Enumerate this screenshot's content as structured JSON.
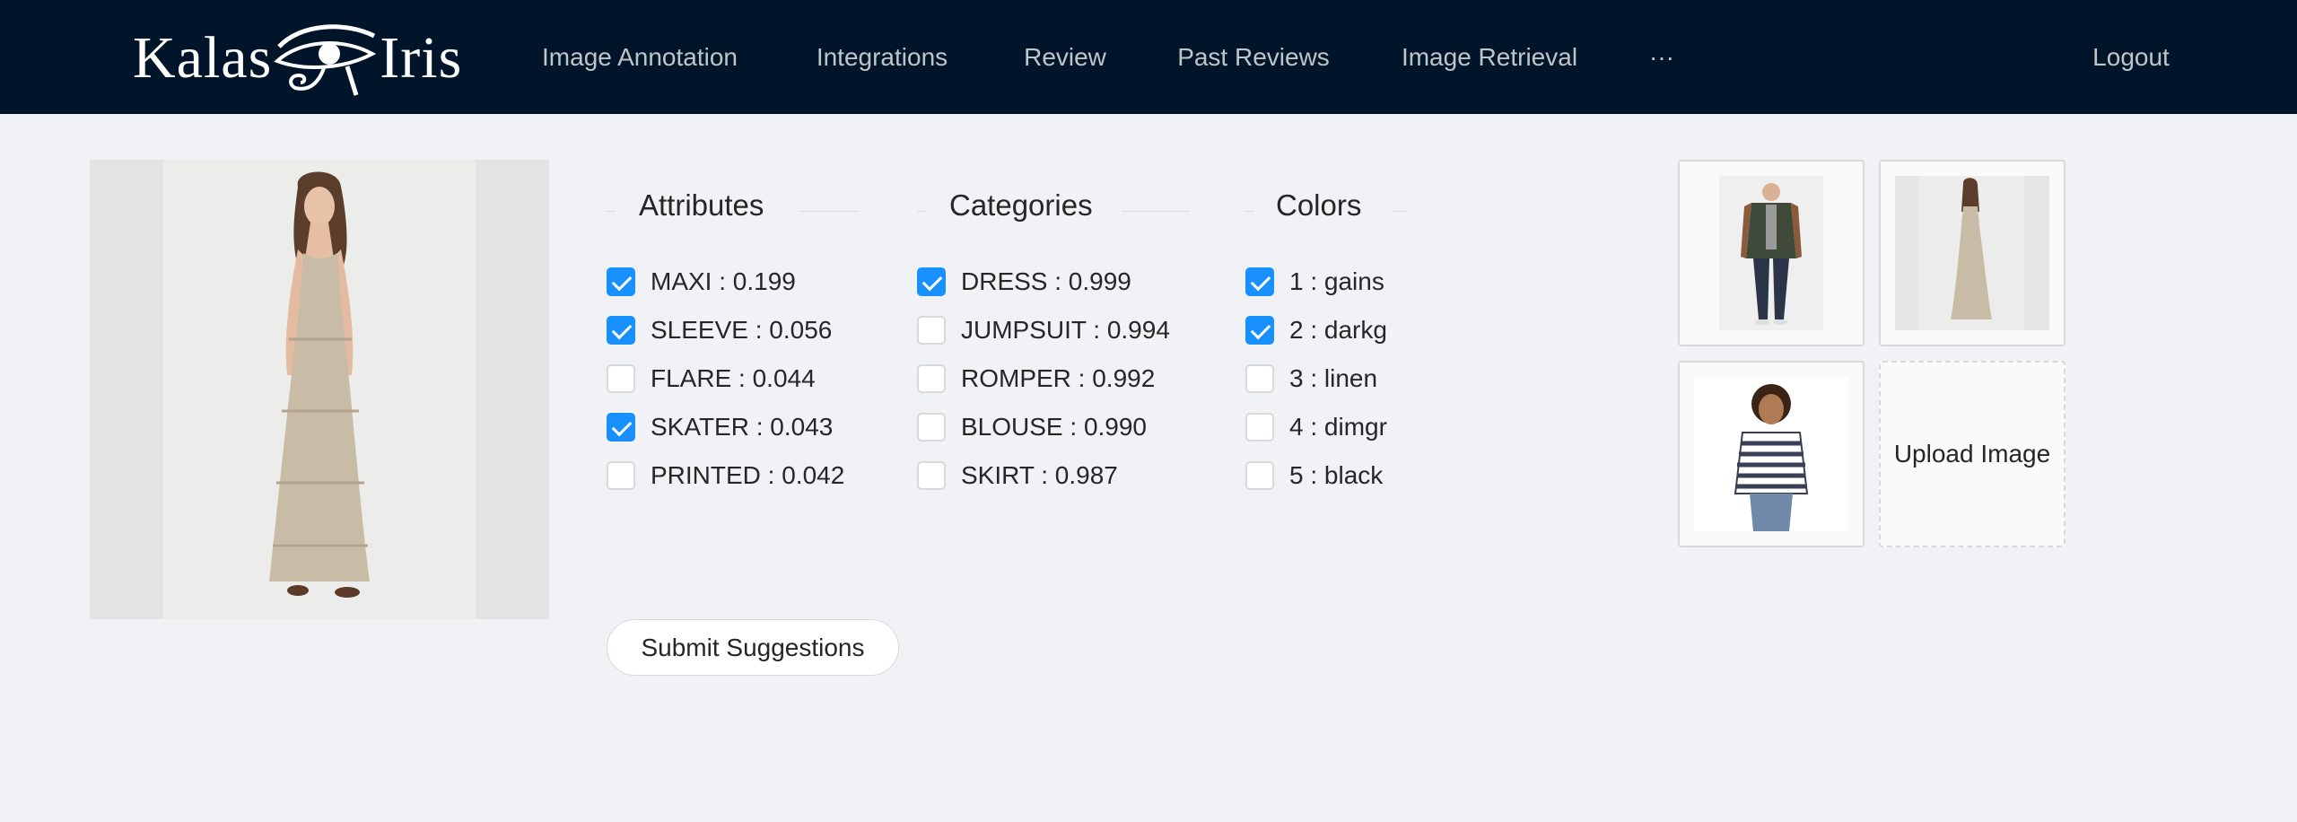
{
  "header": {
    "logo": {
      "left_text": "Kalas",
      "right_text": "Iris",
      "icon": "eye-of-horus-icon"
    },
    "nav": [
      {
        "label": "Image Annotation",
        "active": true
      },
      {
        "label": "Integrations",
        "active": false
      },
      {
        "label": "Review",
        "active": false
      },
      {
        "label": "Past Reviews",
        "active": false
      },
      {
        "label": "Image Retrieval",
        "active": false
      },
      {
        "label": "···",
        "active": false
      }
    ],
    "logout_label": "Logout"
  },
  "groups": {
    "attributes": {
      "title": "Attributes",
      "options": [
        {
          "label": "MAXI : 0.199",
          "checked": true
        },
        {
          "label": "SLEEVE : 0.056",
          "checked": true
        },
        {
          "label": "FLARE : 0.044",
          "checked": false
        },
        {
          "label": "SKATER : 0.043",
          "checked": true
        },
        {
          "label": "PRINTED : 0.042",
          "checked": false
        }
      ]
    },
    "categories": {
      "title": "Categories",
      "options": [
        {
          "label": "DRESS : 0.999",
          "checked": true
        },
        {
          "label": "JUMPSUIT : 0.994",
          "checked": false
        },
        {
          "label": "ROMPER : 0.992",
          "checked": false
        },
        {
          "label": "BLOUSE : 0.990",
          "checked": false
        },
        {
          "label": "SKIRT : 0.987",
          "checked": false
        }
      ]
    },
    "colors": {
      "title": "Colors",
      "options": [
        {
          "label": "1 : gains",
          "checked": true
        },
        {
          "label": "2 : darkg",
          "checked": true
        },
        {
          "label": "3 : linen",
          "checked": false
        },
        {
          "label": "4 : dimgr",
          "checked": false
        },
        {
          "label": "5 : black",
          "checked": false
        }
      ]
    }
  },
  "submit_label": "Submit Suggestions",
  "upload_label": "Upload Image",
  "colors": {
    "header_bg": "#001529",
    "accent": "#1890ff",
    "page_bg": "#f0f2f5"
  }
}
